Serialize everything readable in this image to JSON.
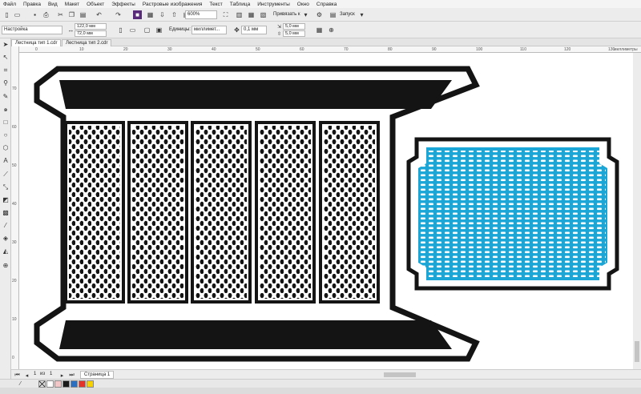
{
  "menubar": {
    "items": [
      "Файл",
      "Правка",
      "Вид",
      "Макет",
      "Объект",
      "Эффекты",
      "Растровые изображения",
      "Текст",
      "Таблица",
      "Инструменты",
      "Окно",
      "Справка"
    ]
  },
  "toolbar_standard": {
    "zoom_value": "600%",
    "snap_label": "Привязать к",
    "launch_label": "Запуск"
  },
  "property_bar": {
    "preset_value": "Настройка",
    "width_value": "122,0 мм",
    "height_value": "72,0 мм",
    "units_label": "Единицы:",
    "units_value": "миллимет...",
    "nudge_value": "0,1 мм",
    "dup_x_value": "5,0 мм",
    "dup_y_value": "5,0 мм"
  },
  "document_tabs": [
    {
      "label": "Лестница тип 1.cdr",
      "active": true
    },
    {
      "label": "Лестница тип 2.cdr",
      "active": false
    }
  ],
  "ruler": {
    "h_labels": [
      "0",
      "10",
      "20",
      "30",
      "40",
      "50",
      "60",
      "70",
      "80",
      "90",
      "100",
      "110",
      "120",
      "130"
    ],
    "unit_label": "миллиметры",
    "v_labels": [
      "70",
      "60",
      "50",
      "40",
      "30",
      "20",
      "10",
      "0"
    ]
  },
  "page_nav": {
    "current": "1",
    "of_label": "из",
    "total": "1",
    "page_tab": "Страница 1"
  },
  "palette_colors": [
    "#ffffff",
    "#f2c6c6",
    "#1a1a1a",
    "#2a6fc0",
    "#e6332a",
    "#f7d100"
  ],
  "colors": {
    "shape_dark": "#141414",
    "shape_blue": "#1aa6d6",
    "canvas": "#ffffff"
  }
}
